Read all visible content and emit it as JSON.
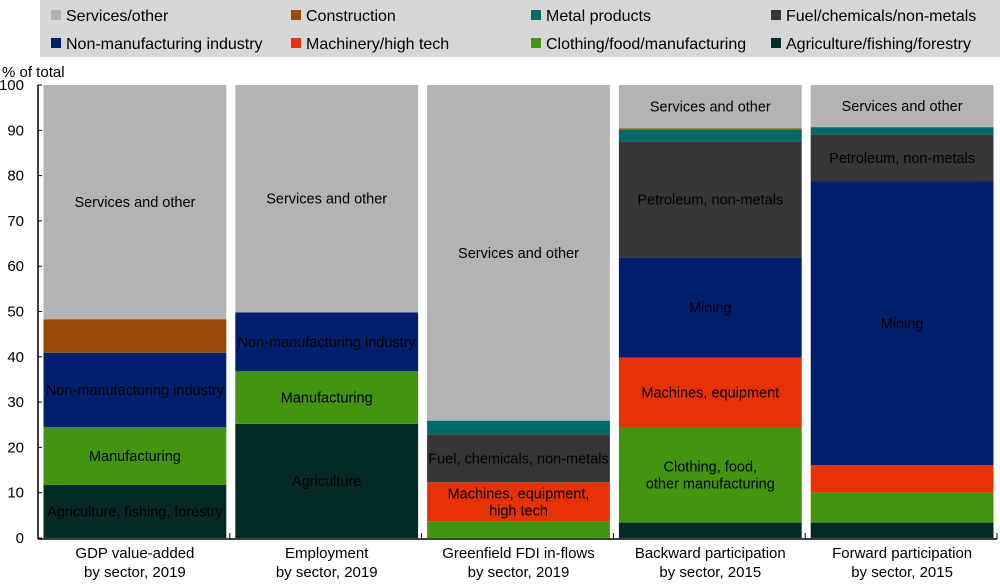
{
  "chart_data": {
    "type": "bar",
    "stacked": true,
    "ylabel": "% of total",
    "ylim": [
      0,
      100
    ],
    "yticks": [
      "0",
      "10",
      "20",
      "30",
      "40",
      "50",
      "60",
      "70",
      "80",
      "90",
      "100"
    ],
    "legend_position": "top",
    "categories": [
      [
        "GDP value-added",
        "by sector, 2019"
      ],
      [
        "Employment",
        "by sector, 2019"
      ],
      [
        "Greenfield FDI in-flows",
        "by sector, 2019"
      ],
      [
        "Backward participation",
        "by sector, 2015"
      ],
      [
        "Forward participation",
        "by sector, 2015"
      ]
    ],
    "legend_order": [
      7,
      6,
      5,
      4,
      3,
      2,
      1,
      0
    ],
    "series": [
      {
        "name": "Agriculture/fishing/forestry",
        "color": "#032a25",
        "values": [
          11.7,
          25.2,
          0,
          3.4,
          3.4
        ]
      },
      {
        "name": "Clothing/food/manufacturing",
        "color": "#43950f",
        "values": [
          12.8,
          11.6,
          3.7,
          21.0,
          6.6
        ]
      },
      {
        "name": "Machinery/high tech",
        "color": "#e63205",
        "values": [
          0,
          0,
          8.6,
          15.4,
          6.1
        ]
      },
      {
        "name": "Non-manufacturing industry",
        "color": "#00206e",
        "values": [
          16.4,
          13.0,
          0,
          22.1,
          62.6
        ]
      },
      {
        "name": "Fuel/chemicals/non-metals",
        "color": "#363636",
        "values": [
          0,
          0,
          10.6,
          25.7,
          10.4
        ]
      },
      {
        "name": "Metal products",
        "color": "#006969",
        "values": [
          0,
          0,
          3.0,
          2.5,
          1.6
        ]
      },
      {
        "name": "Construction",
        "color": "#984807",
        "values": [
          7.4,
          0,
          0,
          0.3,
          0
        ]
      },
      {
        "name": "Services/other",
        "color": "#b3b3b3",
        "values": [
          51.7,
          50.2,
          74.1,
          9.6,
          9.3
        ]
      }
    ],
    "segment_labels": [
      [
        "Agriculture, fishing, forestry",
        "Manufacturing",
        "",
        "Non-manufacturing industry",
        "",
        "",
        "",
        "Services and other"
      ],
      [
        "Agriculture",
        "Manufacturing",
        "",
        "Non-manufacturing industry",
        "",
        "",
        "",
        "Services and other"
      ],
      [
        "",
        "",
        "Machines, equipment,\nhigh tech",
        "",
        "Fuel, chemicals, non-metals",
        "",
        "",
        "Services and other"
      ],
      [
        "",
        "Clothing, food,\nother manufacturing",
        "Machines, equipment",
        "Mining",
        "Petroleum, non-metals",
        "",
        "",
        "Services and other"
      ],
      [
        "",
        "",
        "",
        "Mining",
        "Petroleum, non-metals",
        "",
        "",
        "Services and other"
      ]
    ]
  }
}
